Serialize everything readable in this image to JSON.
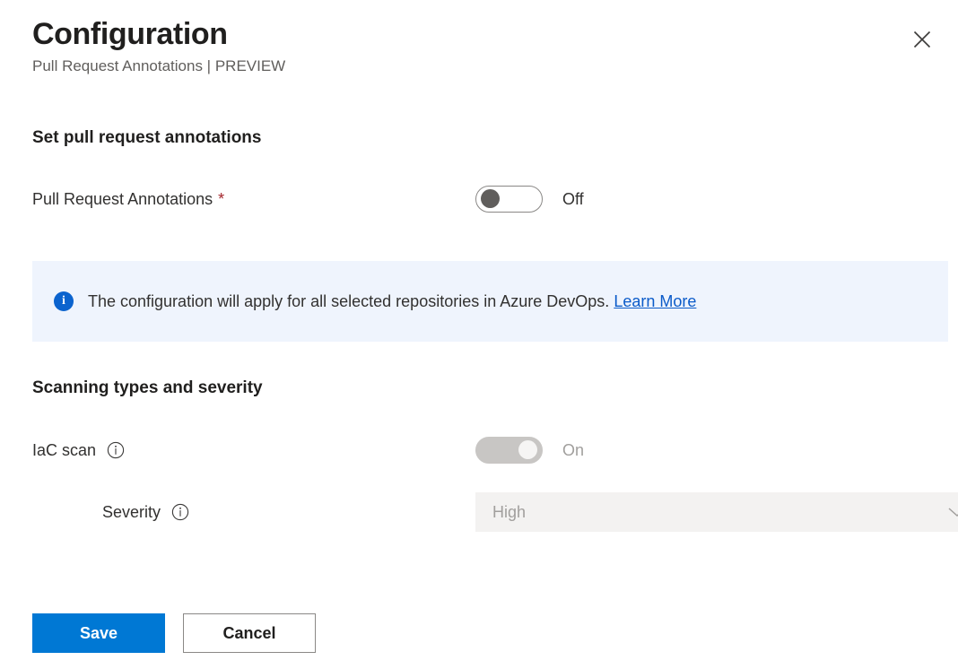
{
  "header": {
    "title": "Configuration",
    "subtitle": "Pull Request Annotations | PREVIEW",
    "close_icon": "close-icon"
  },
  "sections": {
    "annotations": {
      "heading": "Set pull request annotations",
      "field": {
        "label": "Pull Request Annotations",
        "required_marker": "*",
        "toggle_state": "Off",
        "toggle_on": false
      }
    },
    "scanning": {
      "heading": "Scanning types and severity",
      "iac": {
        "label": "IaC scan",
        "info_icon": "info-circle-icon",
        "toggle_state": "On",
        "toggle_on": true,
        "disabled": true
      },
      "severity": {
        "label": "Severity",
        "info_icon": "info-circle-icon",
        "selected_value": "High",
        "disabled": true,
        "chevron_icon": "chevron-down-icon"
      }
    }
  },
  "banner": {
    "icon": "info-filled-icon",
    "icon_glyph": "i",
    "message": "The configuration will apply for all selected repositories in Azure DevOps.",
    "link_text": "Learn More"
  },
  "footer": {
    "save_label": "Save",
    "cancel_label": "Cancel"
  },
  "colors": {
    "primary": "#0078d4",
    "link": "#0b5bc9",
    "required": "#a4262c",
    "banner_bg": "#eff4fd",
    "disabled_text": "#a19f9d",
    "disabled_track": "#c8c6c4"
  }
}
